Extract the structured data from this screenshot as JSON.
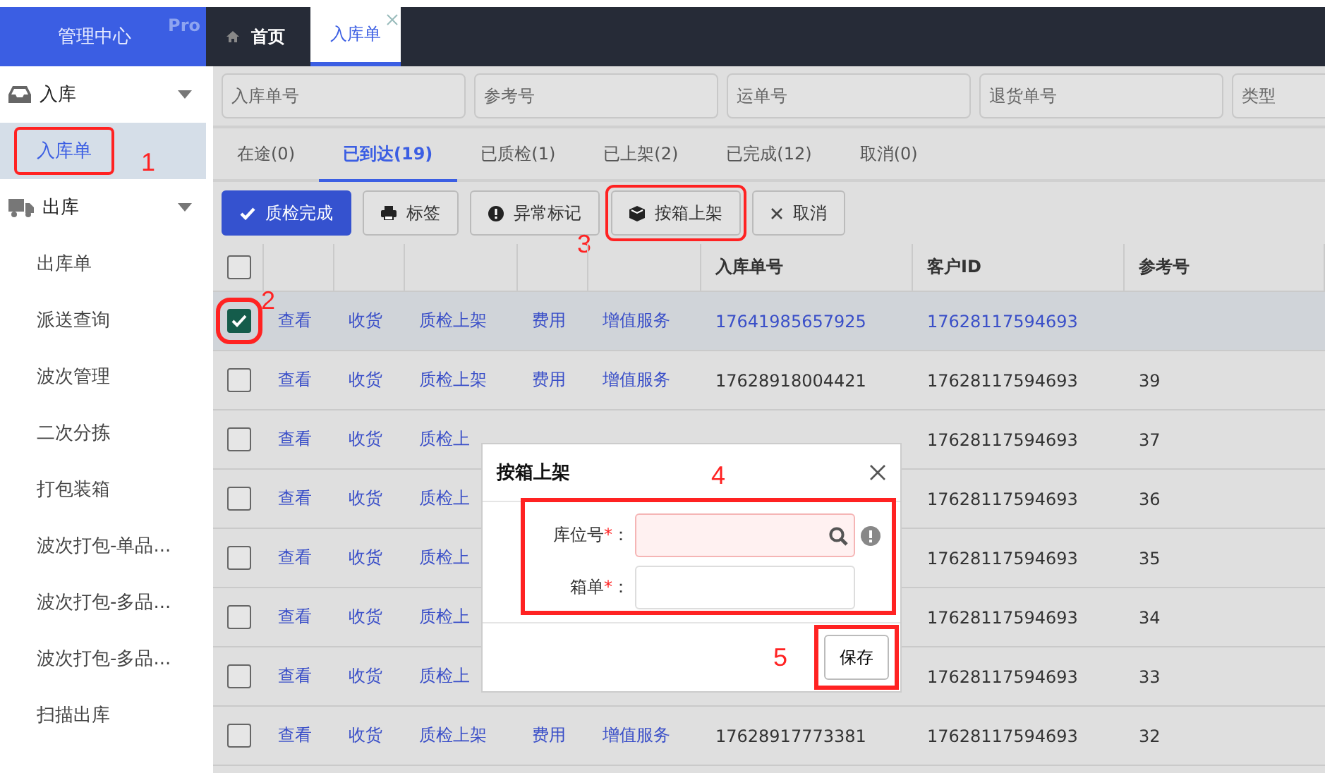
{
  "brand": {
    "title": "管理中心",
    "badge": "Pro"
  },
  "top_tabs": [
    {
      "label": "首页",
      "selected": false,
      "closable": false
    },
    {
      "label": "入库单",
      "selected": true,
      "closable": true
    }
  ],
  "sidebar": {
    "groups": [
      {
        "label": "入库",
        "expanded": true,
        "children": [
          {
            "label": "入库单",
            "selected": true,
            "callout": "1"
          }
        ]
      },
      {
        "label": "出库",
        "expanded": true,
        "children": [
          {
            "label": "出库单",
            "selected": false
          },
          {
            "label": "派送查询",
            "selected": false
          },
          {
            "label": "波次管理",
            "selected": false
          },
          {
            "label": "二次分拣",
            "selected": false
          },
          {
            "label": "打包装箱",
            "selected": false
          },
          {
            "label": "波次打包-单品...",
            "selected": false
          },
          {
            "label": "波次打包-多品...",
            "selected": false
          },
          {
            "label": "波次打包-多品...",
            "selected": false
          },
          {
            "label": "扫描出库",
            "selected": false
          }
        ]
      }
    ]
  },
  "filters": [
    {
      "placeholder": "入库单号"
    },
    {
      "placeholder": "参考号"
    },
    {
      "placeholder": "运单号"
    },
    {
      "placeholder": "退货单号"
    },
    {
      "placeholder": "类型"
    }
  ],
  "status_tabs": [
    {
      "label": "在途(0)",
      "selected": false
    },
    {
      "label": "已到达(19)",
      "selected": true
    },
    {
      "label": "已质检(1)",
      "selected": false
    },
    {
      "label": "已上架(2)",
      "selected": false
    },
    {
      "label": "已完成(12)",
      "selected": false
    },
    {
      "label": "取消(0)",
      "selected": false
    }
  ],
  "toolbar": [
    {
      "label": "质检完成",
      "primary": true
    },
    {
      "label": "标签",
      "primary": false
    },
    {
      "label": "异常标记",
      "primary": false
    },
    {
      "label": "按箱上架",
      "primary": false,
      "callout": "3"
    },
    {
      "label": "取消",
      "primary": false
    }
  ],
  "table": {
    "header_checked": false,
    "columns": [
      "",
      "",
      "",
      "",
      "",
      "",
      "入库单号",
      "客户ID",
      "参考号"
    ],
    "rows": [
      {
        "checked": true,
        "selected": true,
        "callout": "2",
        "actions": [
          "查看",
          "收货",
          "质检上架",
          "费用",
          "增值服务"
        ],
        "order_no": "17641985657925",
        "customer_id": "17628117594693",
        "reference": ""
      },
      {
        "checked": false,
        "selected": false,
        "actions": [
          "查看",
          "收货",
          "质检上架",
          "费用",
          "增值服务"
        ],
        "order_no": "17628918004421",
        "customer_id": "17628117594693",
        "reference": "39"
      },
      {
        "checked": false,
        "selected": false,
        "actions": [
          "查看",
          "收货",
          "质检上"
        ],
        "order_no": "",
        "customer_id": "17628117594693",
        "reference": "37"
      },
      {
        "checked": false,
        "selected": false,
        "actions": [
          "查看",
          "收货",
          "质检上"
        ],
        "order_no": "",
        "customer_id": "17628117594693",
        "reference": "36"
      },
      {
        "checked": false,
        "selected": false,
        "actions": [
          "查看",
          "收货",
          "质检上"
        ],
        "order_no": "",
        "customer_id": "17628117594693",
        "reference": "35"
      },
      {
        "checked": false,
        "selected": false,
        "actions": [
          "查看",
          "收货",
          "质检上"
        ],
        "order_no": "",
        "customer_id": "17628117594693",
        "reference": "34"
      },
      {
        "checked": false,
        "selected": false,
        "actions": [
          "查看",
          "收货",
          "质检上"
        ],
        "order_no": "",
        "customer_id": "17628117594693",
        "reference": "33"
      },
      {
        "checked": false,
        "selected": false,
        "actions": [
          "查看",
          "收货",
          "质检上架",
          "费用",
          "增值服务"
        ],
        "order_no": "17628917773381",
        "customer_id": "17628117594693",
        "reference": "32"
      }
    ]
  },
  "dialog": {
    "title": "按箱上架",
    "callout": "4",
    "fields": [
      {
        "label": "库位号",
        "kind": "lookup",
        "required": true,
        "invalid": true
      },
      {
        "label": "箱单",
        "kind": "text",
        "required": true,
        "invalid": false
      }
    ],
    "required_mark": "*",
    "colon": "：",
    "save": {
      "label": "保存",
      "callout": "5"
    }
  }
}
